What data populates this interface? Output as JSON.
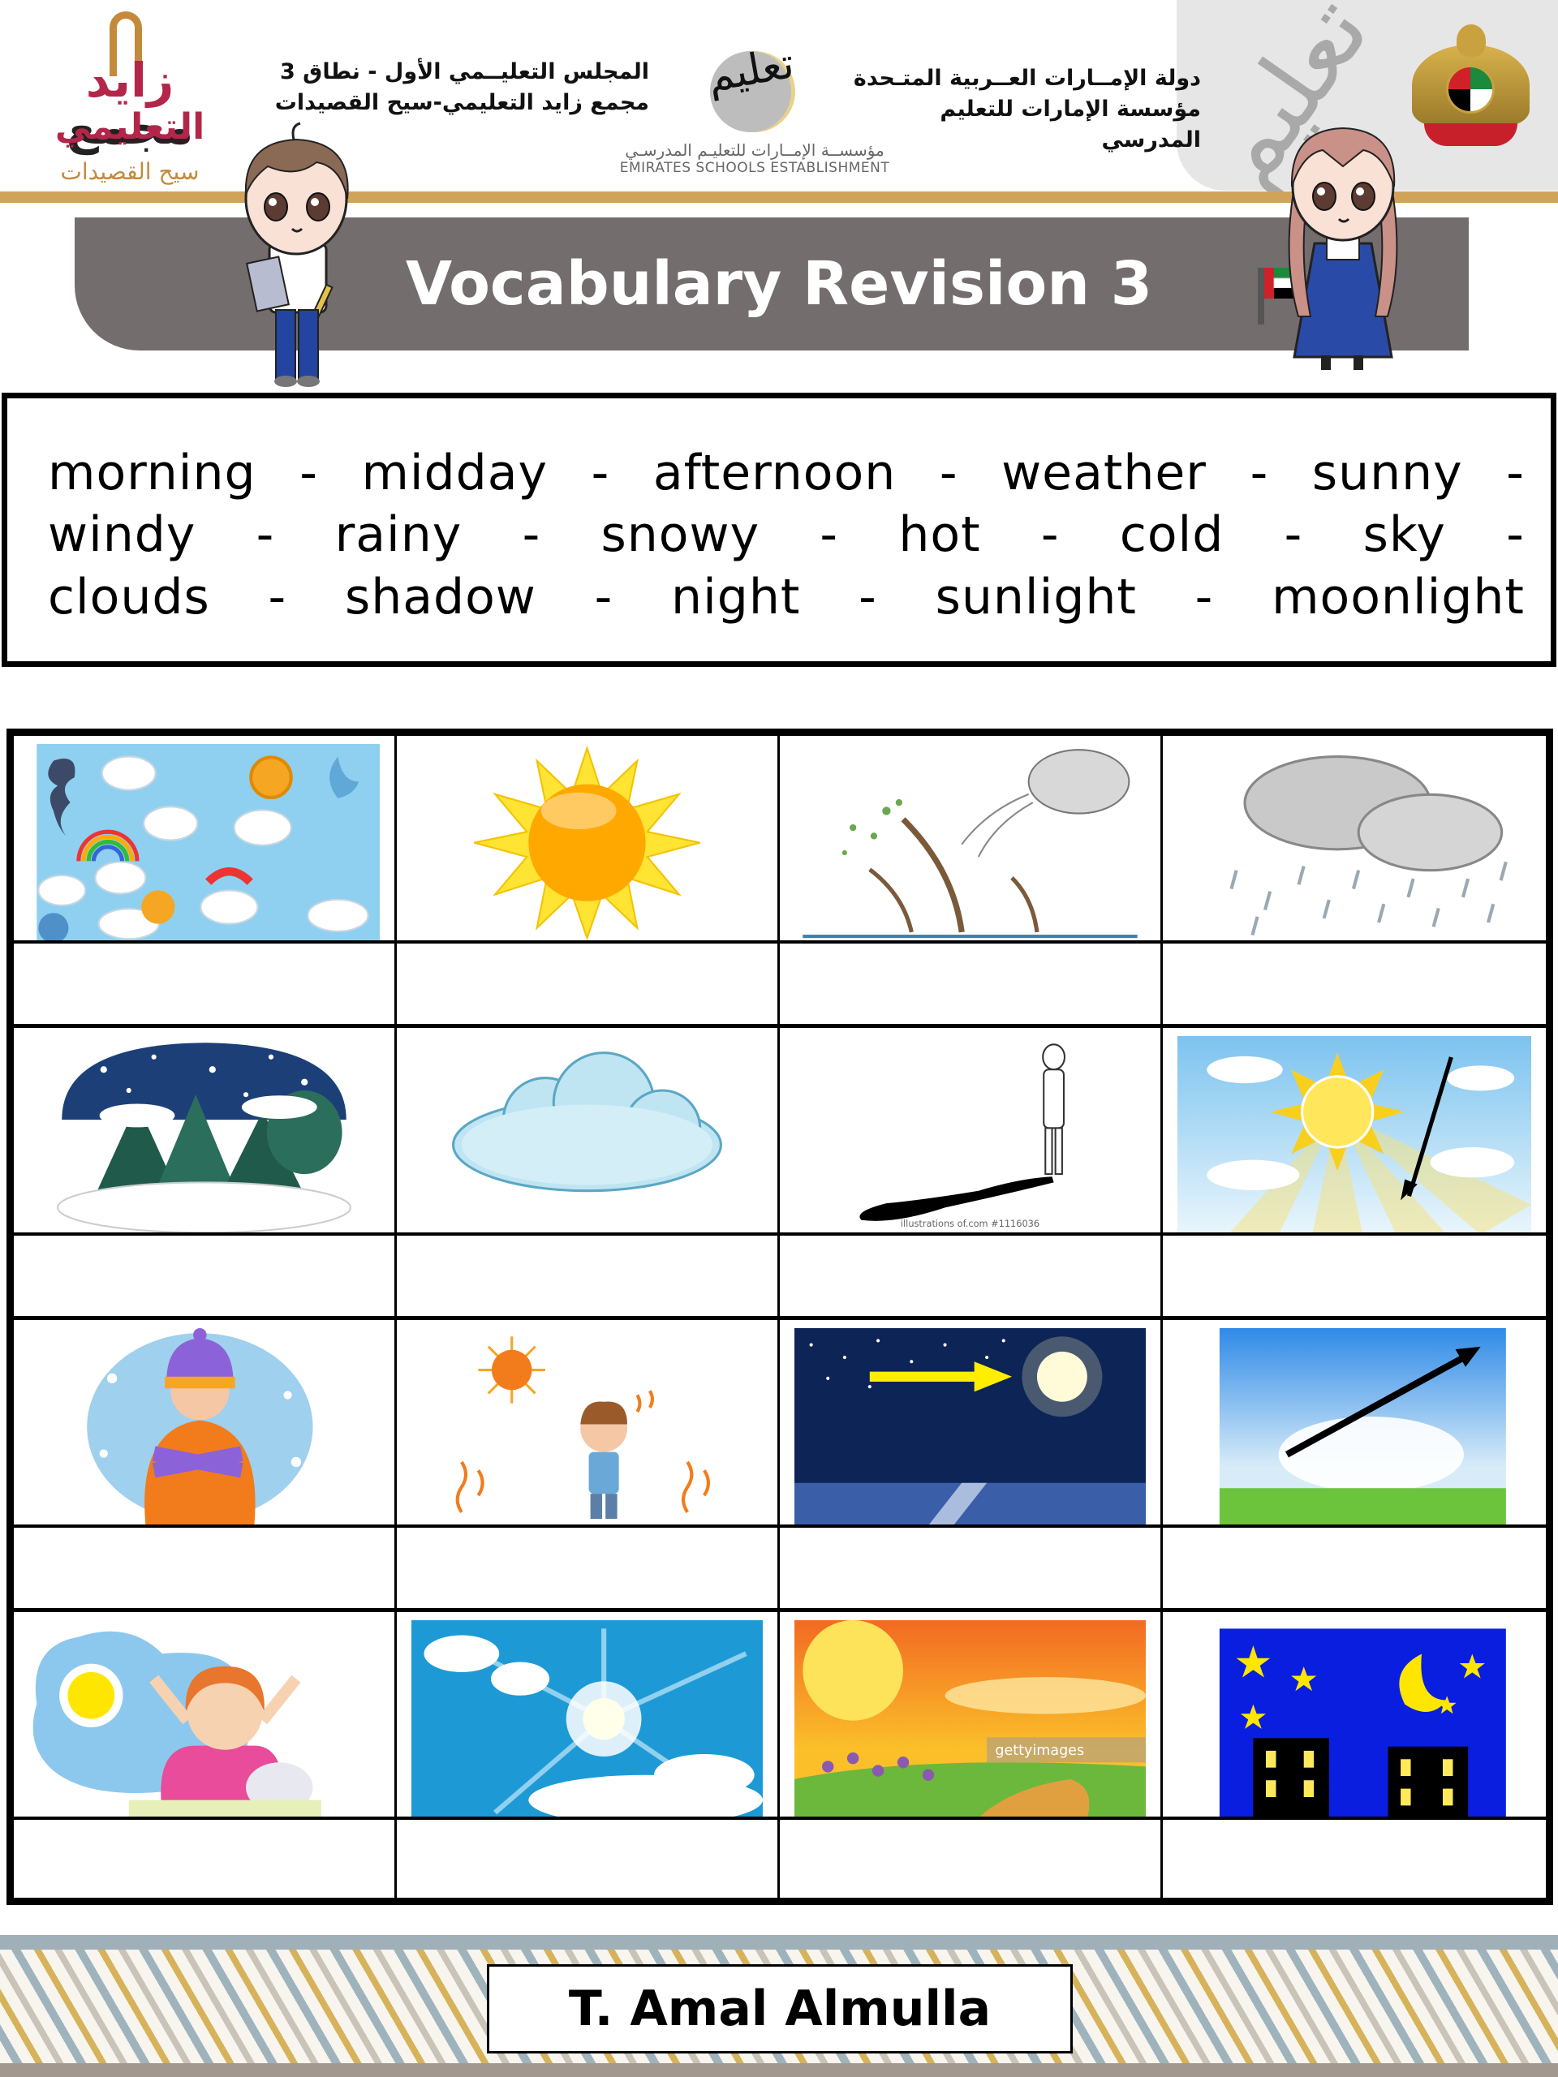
{
  "header": {
    "school_logo": {
      "line1_prefix": "مجمع",
      "line1_name": "زايد",
      "line2": "التعليمي",
      "line3": "سيح القصيدات"
    },
    "left_text": [
      "المجلس التعليــمي الأول - نطاق 3",
      "مجمع زايد التعليمي-سيح القصيدات"
    ],
    "center_logo": {
      "glyph": "تعليم",
      "arabic": "مؤسســة الإمــارات للتعليـم المدرسـي",
      "english": "EMIRATES SCHOOLS ESTABLISHMENT"
    },
    "right_text": [
      "دولة الإمــارات العــربية المتـحدة",
      "مؤسسة الإمارات للتعليم المدرسي"
    ],
    "watermark": "تعليم",
    "emblem_caption": "الإمارات العربية المتحدة"
  },
  "title": "Vocabulary Revision 3",
  "word_bank": {
    "lines": [
      [
        "morning",
        "-",
        "midday",
        "-",
        "afternoon",
        "-",
        "weather",
        "-",
        "sunny",
        "-"
      ],
      [
        "windy",
        "-",
        "rainy",
        "-",
        "snowy",
        "-",
        "hot",
        "-",
        "cold",
        "-",
        "sky",
        "-"
      ],
      [
        "clouds",
        "-",
        "shadow",
        "-",
        "night",
        "-",
        "sunlight",
        "-",
        "moonlight"
      ]
    ]
  },
  "grid": {
    "rows": [
      [
        {
          "picture": "weather-icons-collage",
          "answer": ""
        },
        {
          "picture": "sun",
          "answer": ""
        },
        {
          "picture": "wind-blowing-trees",
          "answer": ""
        },
        {
          "picture": "rain-clouds",
          "answer": ""
        }
      ],
      [
        {
          "picture": "snowy-landscape",
          "answer": ""
        },
        {
          "picture": "cloud",
          "answer": ""
        },
        {
          "picture": "boy-shadow",
          "caption": "illustrations of.com    #1116036",
          "answer": ""
        },
        {
          "picture": "sunlight-arrow",
          "answer": ""
        }
      ],
      [
        {
          "picture": "cold-man-scarf",
          "answer": ""
        },
        {
          "picture": "hot-boy-sun",
          "answer": ""
        },
        {
          "picture": "moonlight-arrow",
          "answer": ""
        },
        {
          "picture": "sky-arrow",
          "answer": ""
        }
      ],
      [
        {
          "picture": "girl-waking-morning",
          "answer": ""
        },
        {
          "picture": "midday-sun-sky",
          "answer": ""
        },
        {
          "picture": "afternoon-sunset",
          "caption": "gettyimages",
          "answer": ""
        },
        {
          "picture": "night-buildings-moon",
          "answer": ""
        }
      ]
    ]
  },
  "footer": {
    "teacher": "T. Amal Almulla"
  },
  "colors": {
    "title_banner": "#736d6e",
    "gold_stripe": "#cfa45a",
    "header_gray": "#e6e6e6"
  }
}
